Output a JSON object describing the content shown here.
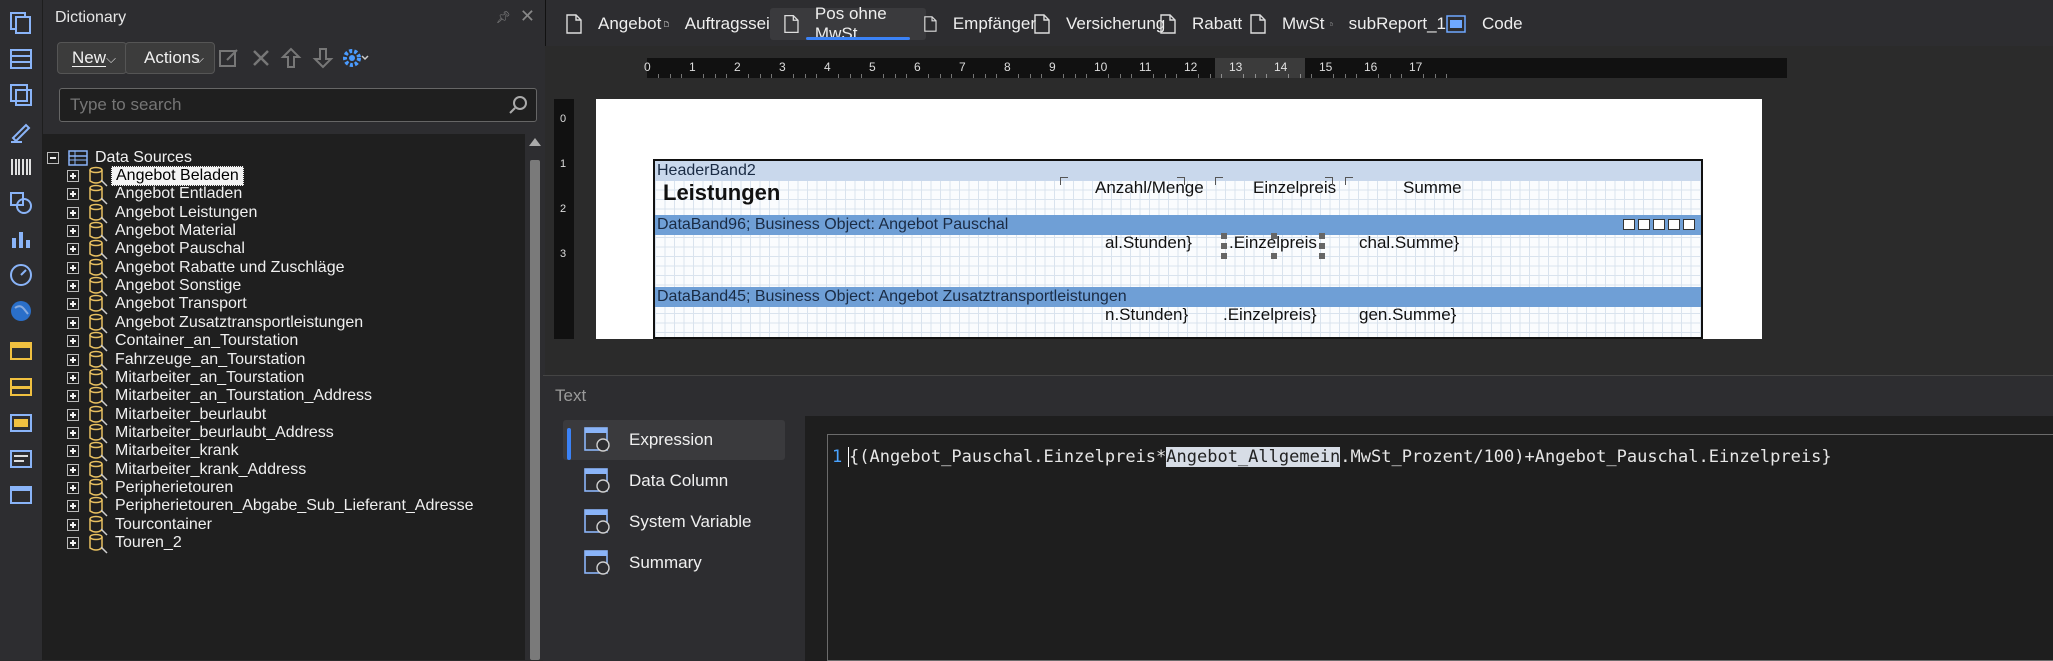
{
  "dictionary": {
    "title": "Dictionary",
    "new_label": "New",
    "actions_label": "Actions",
    "search_placeholder": "Type to search",
    "root_label": "Data Sources",
    "items": [
      "Angebot Beladen",
      "Angebot Entladen",
      "Angebot Leistungen",
      "Angebot Material",
      "Angebot Pauschal",
      "Angebot Rabatte und Zuschläge",
      "Angebot Sonstige",
      "Angebot Transport",
      "Angebot Zusatztransportleistungen",
      "Container_an_Tourstation",
      "Fahrzeuge_an_Tourstation",
      "Mitarbeiter_an_Tourstation",
      "Mitarbeiter_an_Tourstation_Address",
      "Mitarbeiter_beurlaubt",
      "Mitarbeiter_beurlaubt_Address",
      "Mitarbeiter_krank",
      "Mitarbeiter_krank_Address",
      "Peripherietouren",
      "Peripherietouren_Abgabe_Sub_Lieferant_Adresse",
      "Tourcontainer",
      "Touren_2"
    ]
  },
  "tabs": [
    "Angebot",
    "Auftragsseite",
    "Pos ohne MwSt",
    "Empfänger",
    "Versicherung",
    "Rabatt",
    "MwSt",
    "subReport_1",
    "Code"
  ],
  "ruler": {
    "h": [
      "0",
      "1",
      "2",
      "3",
      "4",
      "5",
      "6",
      "7",
      "8",
      "9",
      "10",
      "11",
      "12",
      "13",
      "14",
      "15",
      "16",
      "17"
    ],
    "v": [
      "0",
      "1",
      "2",
      "3"
    ]
  },
  "report": {
    "header_band": "HeaderBand2",
    "title": "Leistungen",
    "col_qty": "Anzahl/Menge",
    "col_price": "Einzelpreis",
    "col_sum": "Summe",
    "data_band_1": "DataBand96; Business Object: Angebot Pauschal",
    "r1_qty": "al.Stunden}",
    "r1_price": ".Einzelpreis",
    "r1_sum": "chal.Summe}",
    "data_band_2": "DataBand45; Business Object: Angebot Zusatztransportleistungen",
    "r2_qty": "n.Stunden}",
    "r2_price": ".Einzelpreis}",
    "r2_sum": "gen.Summe}"
  },
  "dialog": {
    "title": "Text",
    "nav": [
      "Expression",
      "Data Column",
      "System Variable",
      "Summary"
    ],
    "line_number": "1",
    "code_pre": "{(Angebot_Pauschal.Einzelpreis*",
    "code_hl": "Angebot_Allgemein",
    "code_post": ".MwSt_Prozent/100)+Angebot_Pauschal.Einzelpreis}"
  },
  "colors": {
    "accent": "#3b82f6",
    "band_head": "#c9d8ec",
    "band_data": "#6f9fd6"
  }
}
